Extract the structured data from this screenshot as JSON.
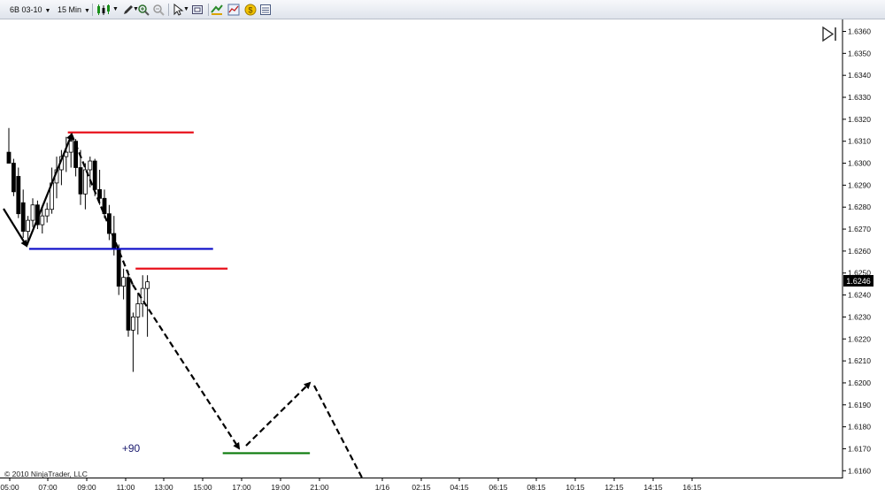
{
  "toolbar": {
    "instrument": "6B 03-10",
    "interval": "15 Min"
  },
  "colors": {
    "red_line": "#e8111b",
    "blue_line": "#0a0ac8",
    "green_line": "#0a7a0a",
    "annotation_text": "#1a1a6e",
    "price_marker_bg": "#000000"
  },
  "chart_data": {
    "type": "candlestick",
    "instrument": "6B 03-10",
    "interval": "15 Min",
    "ylim": [
      1.6155,
      1.6365
    ],
    "y_ticks": [
      "1.6360",
      "1.6350",
      "1.6340",
      "1.6330",
      "1.6320",
      "1.6310",
      "1.6300",
      "1.6290",
      "1.6280",
      "1.6270",
      "1.6260",
      "1.6250",
      "1.6240",
      "1.6230",
      "1.6220",
      "1.6210",
      "1.6200",
      "1.6190",
      "1.6180",
      "1.6170",
      "1.6160"
    ],
    "x_ticks": [
      "05:00",
      "07:00",
      "09:00",
      "11:00",
      "13:00",
      "15:00",
      "17:00",
      "19:00",
      "21:00",
      "1/16",
      "02:15",
      "04:15",
      "06:15",
      "08:15",
      "10:15",
      "12:15",
      "14:15",
      "16:15"
    ],
    "last_price": "1.6246",
    "candles": [
      {
        "o": 1.6305,
        "h": 1.6316,
        "l": 1.63,
        "c": 1.63
      },
      {
        "o": 1.63,
        "h": 1.6302,
        "l": 1.6285,
        "c": 1.6287
      },
      {
        "o": 1.6294,
        "h": 1.6298,
        "l": 1.6275,
        "c": 1.6277
      },
      {
        "o": 1.6282,
        "h": 1.6288,
        "l": 1.6266,
        "c": 1.6269
      },
      {
        "o": 1.6269,
        "h": 1.6276,
        "l": 1.6263,
        "c": 1.6274
      },
      {
        "o": 1.6274,
        "h": 1.6284,
        "l": 1.6271,
        "c": 1.6281
      },
      {
        "o": 1.6281,
        "h": 1.6283,
        "l": 1.627,
        "c": 1.6272
      },
      {
        "o": 1.6272,
        "h": 1.628,
        "l": 1.6268,
        "c": 1.6276
      },
      {
        "o": 1.6276,
        "h": 1.6282,
        "l": 1.6273,
        "c": 1.6279
      },
      {
        "o": 1.6279,
        "h": 1.6298,
        "l": 1.6277,
        "c": 1.6291
      },
      {
        "o": 1.6291,
        "h": 1.6303,
        "l": 1.6284,
        "c": 1.6297
      },
      {
        "o": 1.6297,
        "h": 1.6306,
        "l": 1.629,
        "c": 1.6303
      },
      {
        "o": 1.6303,
        "h": 1.6312,
        "l": 1.6296,
        "c": 1.6305
      },
      {
        "o": 1.6305,
        "h": 1.6314,
        "l": 1.6298,
        "c": 1.631
      },
      {
        "o": 1.631,
        "h": 1.6311,
        "l": 1.6294,
        "c": 1.6298
      },
      {
        "o": 1.6298,
        "h": 1.6306,
        "l": 1.6281,
        "c": 1.6286
      },
      {
        "o": 1.6286,
        "h": 1.63,
        "l": 1.6279,
        "c": 1.6297
      },
      {
        "o": 1.6297,
        "h": 1.6303,
        "l": 1.6289,
        "c": 1.6301
      },
      {
        "o": 1.6301,
        "h": 1.6302,
        "l": 1.6285,
        "c": 1.6288
      },
      {
        "o": 1.6288,
        "h": 1.6297,
        "l": 1.6281,
        "c": 1.6284
      },
      {
        "o": 1.6284,
        "h": 1.6288,
        "l": 1.6275,
        "c": 1.6277
      },
      {
        "o": 1.6277,
        "h": 1.6281,
        "l": 1.6265,
        "c": 1.6268
      },
      {
        "o": 1.6268,
        "h": 1.6276,
        "l": 1.6258,
        "c": 1.6261
      },
      {
        "o": 1.6261,
        "h": 1.6263,
        "l": 1.624,
        "c": 1.6244
      },
      {
        "o": 1.6244,
        "h": 1.6252,
        "l": 1.6238,
        "c": 1.6248
      },
      {
        "o": 1.6248,
        "h": 1.6251,
        "l": 1.6221,
        "c": 1.6224
      },
      {
        "o": 1.6224,
        "h": 1.6232,
        "l": 1.6205,
        "c": 1.623
      },
      {
        "o": 1.623,
        "h": 1.6241,
        "l": 1.6222,
        "c": 1.6236
      },
      {
        "o": 1.6236,
        "h": 1.6249,
        "l": 1.623,
        "c": 1.6243
      },
      {
        "o": 1.6243,
        "h": 1.6249,
        "l": 1.6221,
        "c": 1.6246
      }
    ],
    "annotations": [
      {
        "type": "hline",
        "color": "red",
        "y": 1.6314,
        "x_from": "08:00",
        "x_to": "14:30"
      },
      {
        "type": "hline",
        "color": "blue",
        "y": 1.6261,
        "x_from": "06:00",
        "x_to": "15:30"
      },
      {
        "type": "hline",
        "color": "red",
        "y": 1.6252,
        "x_from": "11:30",
        "x_to": "16:15"
      },
      {
        "type": "hline",
        "color": "green",
        "y": 1.6168,
        "x_from": "16:00",
        "x_to": "20:30"
      },
      {
        "type": "text",
        "label": "+90",
        "price": 1.6174
      }
    ]
  },
  "footer": {
    "copyright": "© 2010 NinjaTrader, LLC"
  }
}
